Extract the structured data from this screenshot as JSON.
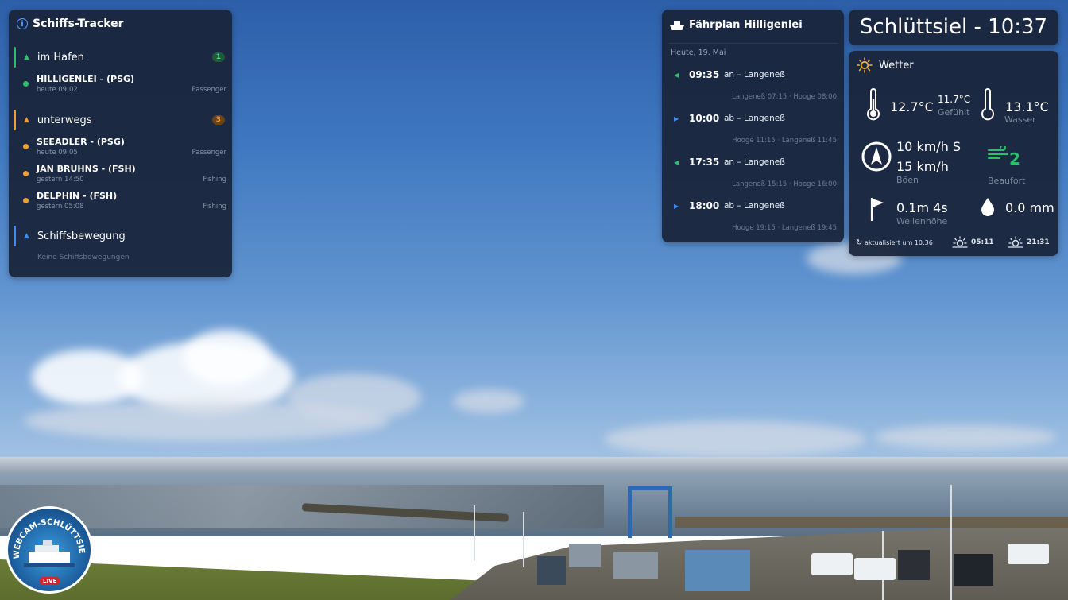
{
  "tracker": {
    "title": "Schiffs-Tracker",
    "groups": [
      {
        "label": "im Hafen",
        "count": "1",
        "color": "#2fbf6a"
      },
      {
        "label": "unterwegs",
        "count": "3",
        "color": "#f0a030"
      },
      {
        "label": "Schiffsbewegung",
        "count": "",
        "color": "#3d8ef0"
      }
    ],
    "vessels": [
      {
        "name": "HILLIGENLEI - (PSG)",
        "time": "heute 09:02",
        "type": "Passenger",
        "status_color": "#2fbf6a"
      },
      {
        "name": "SEEADLER - (PSG)",
        "time": "heute 09:05",
        "type": "Passenger",
        "status_color": "#f0a030"
      },
      {
        "name": "JAN BRUHNS - (FSH)",
        "time": "gestern 14:50",
        "type": "Fishing",
        "status_color": "#f0a030"
      },
      {
        "name": "DELPHIN - (FSH)",
        "time": "gestern 05:08",
        "type": "Fishing",
        "status_color": "#f0a030"
      }
    ],
    "no_movements": "Keine Schiffsbewegungen"
  },
  "ferry": {
    "title": "Fährplan Hilligenlei",
    "date": "Heute, 19. Mai",
    "departures": [
      {
        "time": "09:35",
        "route": "an – Langeneß",
        "stops": "Langeneß 07:15 · Hooge 08:00",
        "direction": "arrive"
      },
      {
        "time": "10:00",
        "route": "ab – Langeneß",
        "stops": "Hooge 11:15 · Langeneß 11:45",
        "direction": "depart"
      },
      {
        "time": "17:35",
        "route": "an – Langeneß",
        "stops": "Langeneß 15:15 · Hooge 16:00",
        "direction": "arrive"
      },
      {
        "time": "18:00",
        "route": "ab – Langeneß",
        "stops": "Hooge 19:15 · Langeneß 19:45",
        "direction": "depart"
      }
    ],
    "arrive_color": "#2fbf6a",
    "depart_color": "#3d8ef0"
  },
  "clock": {
    "text": "Schlüttsiel - 10:37"
  },
  "weather": {
    "title": "Wetter",
    "air_temp": "12.7°C",
    "feels_temp": "11.7°C",
    "feels_label": "Gefühlt",
    "water_temp": "13.1°C",
    "water_label": "Wasser",
    "wind": "10 km/h S",
    "gusts": "15 km/h",
    "gusts_label": "Böen",
    "beaufort_value": "2",
    "beaufort_label": "Beaufort",
    "wave": "0.1m 4s",
    "wave_label": "Wellenhöhe",
    "rain": "0.0 mm",
    "updated": "aktualisiert um 10:36",
    "sunrise": "05:11",
    "sunset": "21:31",
    "icons": [
      "sun-icon",
      "thermometer-icon",
      "compass-icon",
      "wind-icon",
      "flag-icon",
      "raindrop-icon",
      "refresh-icon",
      "sunrise-icon",
      "sunset-icon"
    ]
  },
  "logo": {
    "text": "WEBCAM-SCHLÜTTSIEL",
    "live": "LIVE"
  }
}
